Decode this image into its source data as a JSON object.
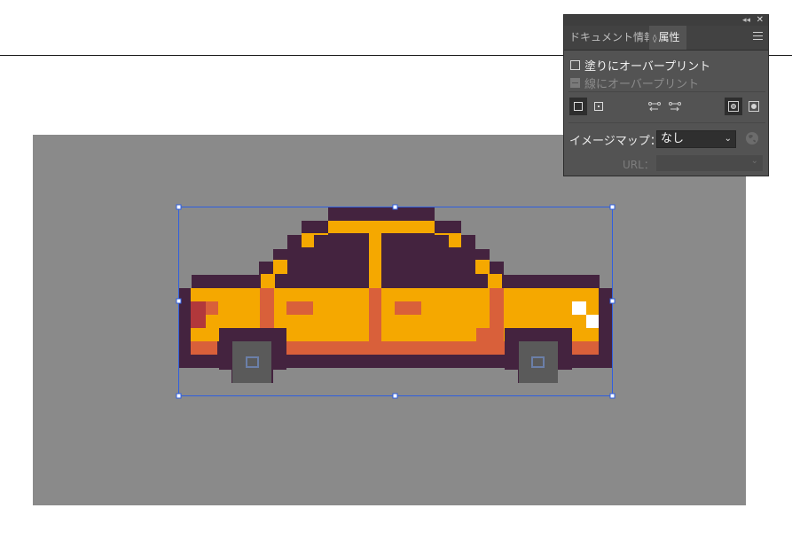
{
  "panel": {
    "tabs": {
      "document_info": "ドキュメント情報",
      "attributes": "属性"
    },
    "overprint_fill": "塗りにオーバープリント",
    "overprint_stroke": "線にオーバープリント",
    "image_map_label": "イメージマップ：",
    "image_map_value": "なし",
    "url_label": "URL：",
    "icons": [
      "collapse-icon",
      "close-icon",
      "panel-menu-icon",
      "globe-icon"
    ]
  },
  "canvas": {
    "artboard_color": "#8a8a8a",
    "car_colors": {
      "outline": "#44233f",
      "body": "#f5a800",
      "accent": "#d9603a",
      "headlight": "#b2383b",
      "wheel": "#5a5a5a",
      "window_glint": "#ffffff",
      "selection": "#2f5fe0"
    }
  }
}
